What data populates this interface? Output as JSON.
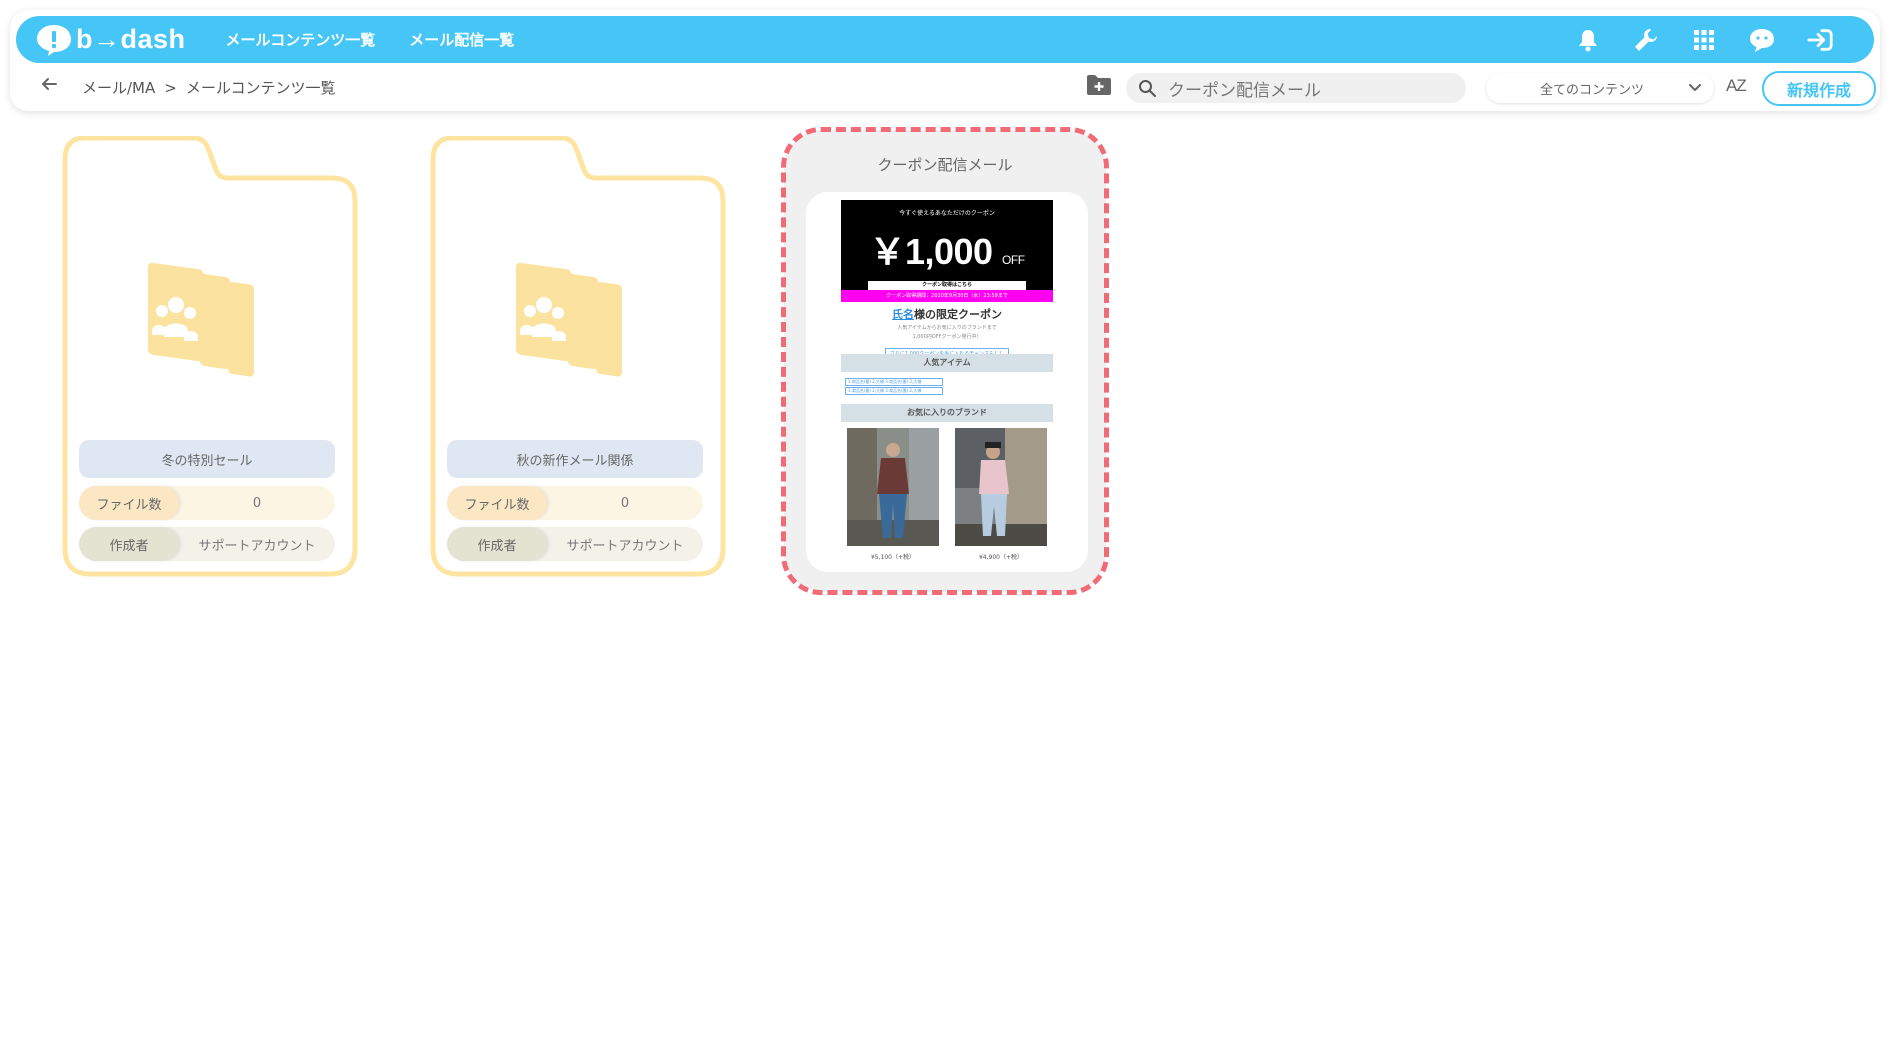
{
  "header": {
    "logo_text": "b→dash",
    "nav": [
      "メールコンテンツ一覧",
      "メール配信一覧"
    ],
    "colors": {
      "brand": "#45c6f6",
      "folder": "#fde4a0",
      "highlight": "#f06b76"
    },
    "icons": [
      "bell-icon",
      "wrench-icon",
      "apps-grid-icon",
      "chat-icon",
      "logout-icon"
    ]
  },
  "toolbar": {
    "breadcrumb": [
      "メール/MA",
      "メールコンテンツ一覧"
    ],
    "breadcrumb_sep": ">",
    "search_value": "クーポン配信メール",
    "filter_value": "全てのコンテンツ",
    "sort_label": "AZ",
    "new_button": "新規作成"
  },
  "folders": [
    {
      "name": "冬の特別セール",
      "files_label": "ファイル数",
      "files_count": "0",
      "author_label": "作成者",
      "author": "サポートアカウント"
    },
    {
      "name": "秋の新作メール関係",
      "files_label": "ファイル数",
      "files_count": "0",
      "author_label": "作成者",
      "author": "サポートアカウント"
    }
  ],
  "mail_card": {
    "title": "クーポン配信メール",
    "preview": {
      "top_line": "今すぐ使えるあなただけのクーポン",
      "amount": "￥1,000",
      "amount_suffix": "OFF",
      "button": "クーポン取得はこちら",
      "limit": "クーポン取得期間：2020年9月30日（水）23:59まで",
      "name_tag": "氏名",
      "headline_rest": "様の限定クーポン",
      "line1": "人気アイテムからお気に入りのブランドまで",
      "line2": "1,000円OFFクーポン発行中！",
      "link": "さらに1,000クーポンを手に入れるチャンスも！！",
      "section1": "人気アイテム",
      "item_links": [
        "1.商品名(番)  2,大様  3.商品名(番)  2,大様",
        "1.商品名(番)  2,大様  3.商品名(番)  2,大様"
      ],
      "section2": "お気に入りのブランド",
      "price1": "¥5,100（+税）",
      "price2": "¥4,900（+税）"
    }
  }
}
